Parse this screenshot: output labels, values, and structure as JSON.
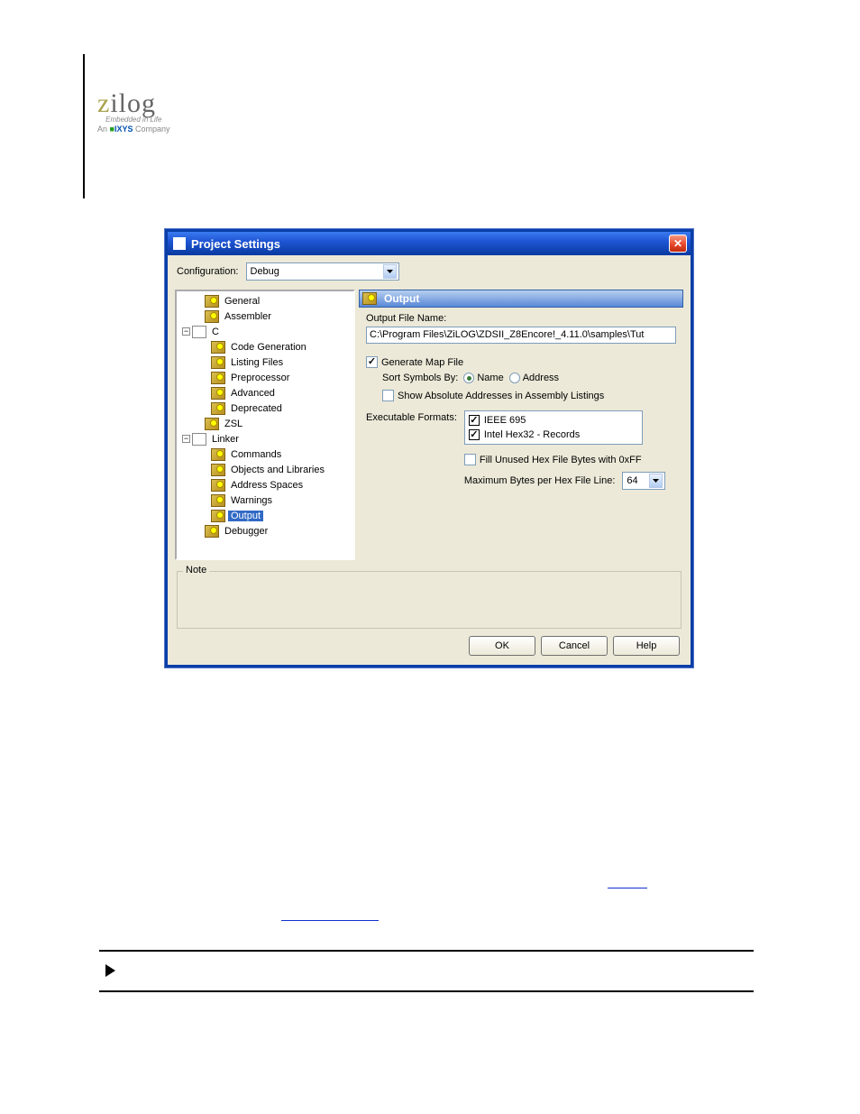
{
  "logo": {
    "brand": "zilog",
    "tagline": "Embedded in Life",
    "company_prefix": "An",
    "company": "IXYS",
    "company_suffix": "Company"
  },
  "dialog": {
    "title": "Project Settings",
    "config_label": "Configuration:",
    "config_value": "Debug",
    "tree": {
      "general": "General",
      "assembler": "Assembler",
      "c": "C",
      "codegen": "Code Generation",
      "listing": "Listing Files",
      "preproc": "Preprocessor",
      "advanced": "Advanced",
      "deprecated": "Deprecated",
      "zsl": "ZSL",
      "linker": "Linker",
      "commands": "Commands",
      "objlib": "Objects and Libraries",
      "addrsp": "Address Spaces",
      "warnings": "Warnings",
      "output": "Output",
      "debugger": "Debugger"
    },
    "panel": {
      "heading": "Output",
      "outname_label": "Output File Name:",
      "outname_value": "C:\\Program Files\\ZiLOG\\ZDSII_Z8Encore!_4.11.0\\samples\\Tut",
      "genmap": "Generate Map File",
      "sortby": "Sort Symbols By:",
      "name": "Name",
      "address": "Address",
      "showabs": "Show Absolute Addresses in Assembly Listings",
      "execfmt": "Executable Formats:",
      "fmt1": "IEEE 695",
      "fmt2": "Intel Hex32 - Records",
      "fill": "Fill Unused Hex File Bytes with 0xFF",
      "maxbytes": "Maximum Bytes per Hex File Line:",
      "maxbytes_val": "64"
    },
    "note_label": "Note",
    "buttons": {
      "ok": "OK",
      "cancel": "Cancel",
      "help": "Help"
    }
  }
}
